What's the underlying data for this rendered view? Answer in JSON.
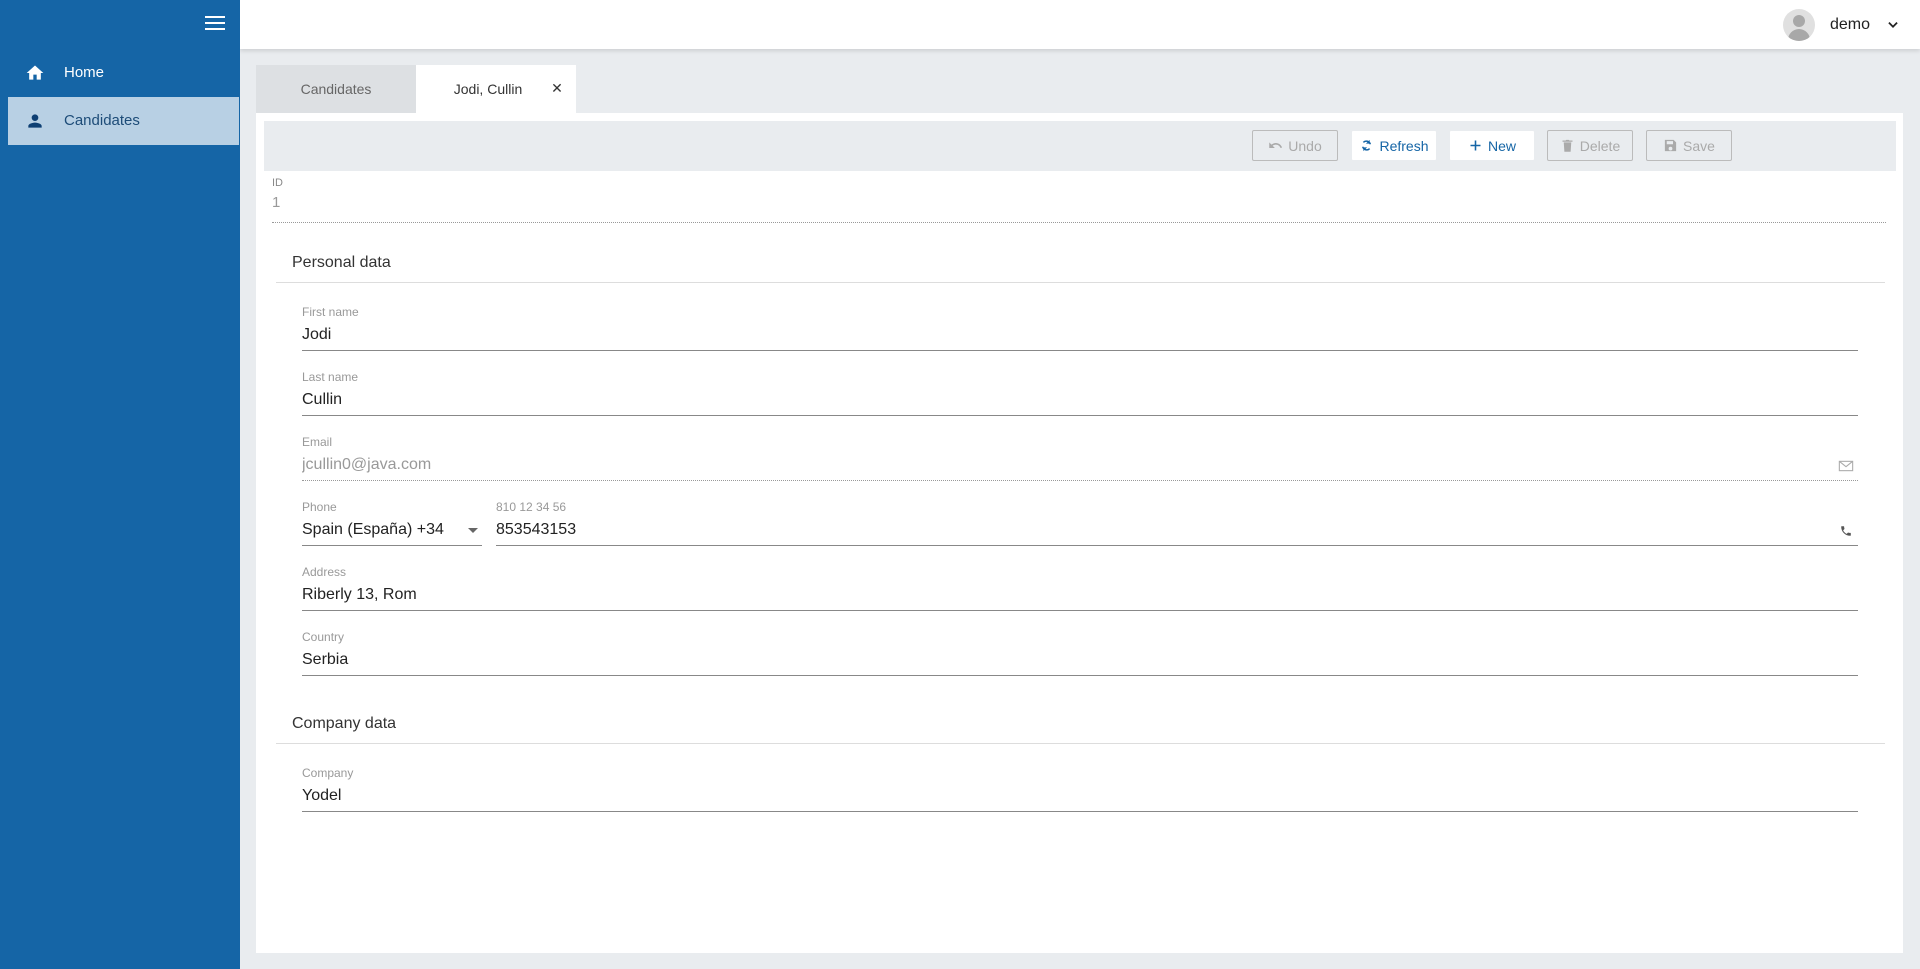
{
  "sidebar": {
    "menu_icon": "hamburger-menu-icon",
    "items": [
      {
        "label": "Home",
        "icon": "home-icon",
        "selected": false
      },
      {
        "label": "Candidates",
        "icon": "person-icon",
        "selected": true
      }
    ]
  },
  "header": {
    "user_name": "demo",
    "avatar_icon": "user-avatar-icon",
    "chevron_icon": "chevron-down-icon"
  },
  "tabs": [
    {
      "label": "Candidates",
      "active": false
    },
    {
      "label": "Jodi, Cullin",
      "active": true,
      "close_icon": "close-icon",
      "close_glyph": "✕"
    }
  ],
  "toolbar": {
    "undo": {
      "label": "Undo",
      "icon": "undo-icon",
      "enabled": false
    },
    "refresh": {
      "label": "Refresh",
      "icon": "refresh-icon",
      "enabled": true
    },
    "new": {
      "label": "New",
      "icon": "plus-icon",
      "enabled": true
    },
    "delete": {
      "label": "Delete",
      "icon": "trash-icon",
      "enabled": false
    },
    "save": {
      "label": "Save",
      "icon": "floppy-disk-icon",
      "enabled": false
    }
  },
  "record": {
    "id_label": "ID",
    "id_value": "1"
  },
  "sections": {
    "personal": {
      "title": "Personal data",
      "first_name": {
        "label": "First name",
        "value": "Jodi"
      },
      "last_name": {
        "label": "Last name",
        "value": "Cullin"
      },
      "email": {
        "label": "Email",
        "value": "jcullin0@java.com",
        "icon": "envelope-icon",
        "readonly": true
      },
      "phone": {
        "label": "Phone",
        "country_selected": "Spain (España) +34",
        "number_placeholder": "810 12 34 56",
        "number_value": "853543153",
        "icon": "phone-icon"
      },
      "address": {
        "label": "Address",
        "value": "Riberly 13, Rom"
      },
      "country": {
        "label": "Country",
        "value": "Serbia"
      }
    },
    "company": {
      "title": "Company data",
      "company": {
        "label": "Company",
        "value": "Yodel"
      }
    }
  },
  "colors": {
    "sidebar": "#1565a6",
    "sidebar_selected": "#b8d0e4",
    "accent": "#1565a6",
    "background": "#e9ecef"
  }
}
